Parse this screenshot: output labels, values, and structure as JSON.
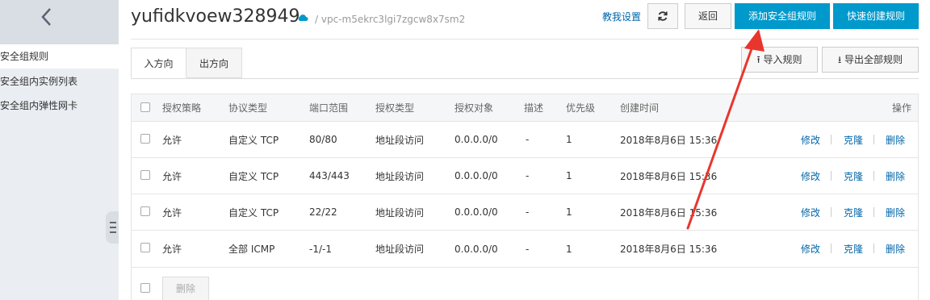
{
  "sidebar": {
    "items": [
      {
        "label": "安全组规则",
        "active": true
      },
      {
        "label": "安全组内实例列表",
        "active": false
      },
      {
        "label": "安全组内弹性网卡",
        "active": false
      }
    ]
  },
  "header": {
    "title": "yufidkvoew328949",
    "vpc": "/ vpc-m5ekrc3lgi7zgcw8x7sm2",
    "help_link": "教我设置",
    "back_label": "返回",
    "add_rule_label": "添加安全组规则",
    "quick_create_label": "快速创建规则"
  },
  "tabs": [
    {
      "label": "入方向",
      "active": true
    },
    {
      "label": "出方向",
      "active": false
    }
  ],
  "toolbar": {
    "import_label": "导入规则",
    "export_label": "导出全部规则"
  },
  "table": {
    "columns": [
      "授权策略",
      "协议类型",
      "端口范围",
      "授权类型",
      "授权对象",
      "描述",
      "优先级",
      "创建时间",
      "操作"
    ],
    "rows": [
      {
        "policy": "允许",
        "protocol": "自定义 TCP",
        "port": "80/80",
        "auth_type": "地址段访问",
        "auth_obj": "0.0.0.0/0",
        "desc": "-",
        "priority": "1",
        "time": "2018年8月6日 15:36"
      },
      {
        "policy": "允许",
        "protocol": "自定义 TCP",
        "port": "443/443",
        "auth_type": "地址段访问",
        "auth_obj": "0.0.0.0/0",
        "desc": "-",
        "priority": "1",
        "time": "2018年8月6日 15:36"
      },
      {
        "policy": "允许",
        "protocol": "自定义 TCP",
        "port": "22/22",
        "auth_type": "地址段访问",
        "auth_obj": "0.0.0.0/0",
        "desc": "-",
        "priority": "1",
        "time": "2018年8月6日 15:36"
      },
      {
        "policy": "允许",
        "protocol": "全部 ICMP",
        "port": "-1/-1",
        "auth_type": "地址段访问",
        "auth_obj": "0.0.0.0/0",
        "desc": "-",
        "priority": "1",
        "time": "2018年8月6日 15:36"
      }
    ],
    "actions": {
      "modify": "修改",
      "clone": "克隆",
      "delete": "删除"
    }
  },
  "footer": {
    "delete_label": "删除"
  },
  "colors": {
    "primary": "#0099cc",
    "link": "#0066aa",
    "annotation_arrow": "#e8362f"
  }
}
